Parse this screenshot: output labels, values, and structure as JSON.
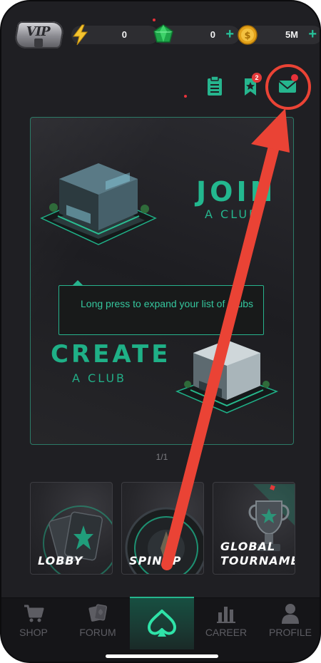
{
  "topbar": {
    "vip_label": "VIP",
    "energy": {
      "value": "0",
      "icon": "lightning-icon"
    },
    "gems": {
      "value": "0",
      "plus": "+",
      "icon": "gem-icon"
    },
    "coins": {
      "value": "5M",
      "plus": "+",
      "icon": "coin-icon"
    }
  },
  "iconrow": {
    "missions_icon": "clipboard-icon",
    "favorites_badge": "2",
    "favorites_icon": "bookmark-star-icon",
    "mail_icon": "envelope-icon"
  },
  "clubs": {
    "join_title": "JOIN",
    "join_subtitle": "A CLUB",
    "create_title": "CREATE",
    "create_subtitle": "A CLUB",
    "tooltip": "Long press to expand your list of Clubs",
    "pager": "1/1"
  },
  "modes": [
    {
      "label": "LOBBY"
    },
    {
      "label": "SPINUP"
    },
    {
      "label": "GLOBAL\nTOURNAMENT"
    }
  ],
  "nav": {
    "items": [
      {
        "label": "SHOP",
        "icon": "cart-icon"
      },
      {
        "label": "FORUM",
        "icon": "cards-icon"
      },
      {
        "label": "",
        "icon": "spade-logo-icon"
      },
      {
        "label": "CAREER",
        "icon": "bar-chart-icon"
      },
      {
        "label": "PROFILE",
        "icon": "person-icon"
      }
    ]
  },
  "colors": {
    "accent": "#25b68d",
    "background": "#1f1f23",
    "annotation": "#ea4335",
    "notification": "#e8323a"
  }
}
